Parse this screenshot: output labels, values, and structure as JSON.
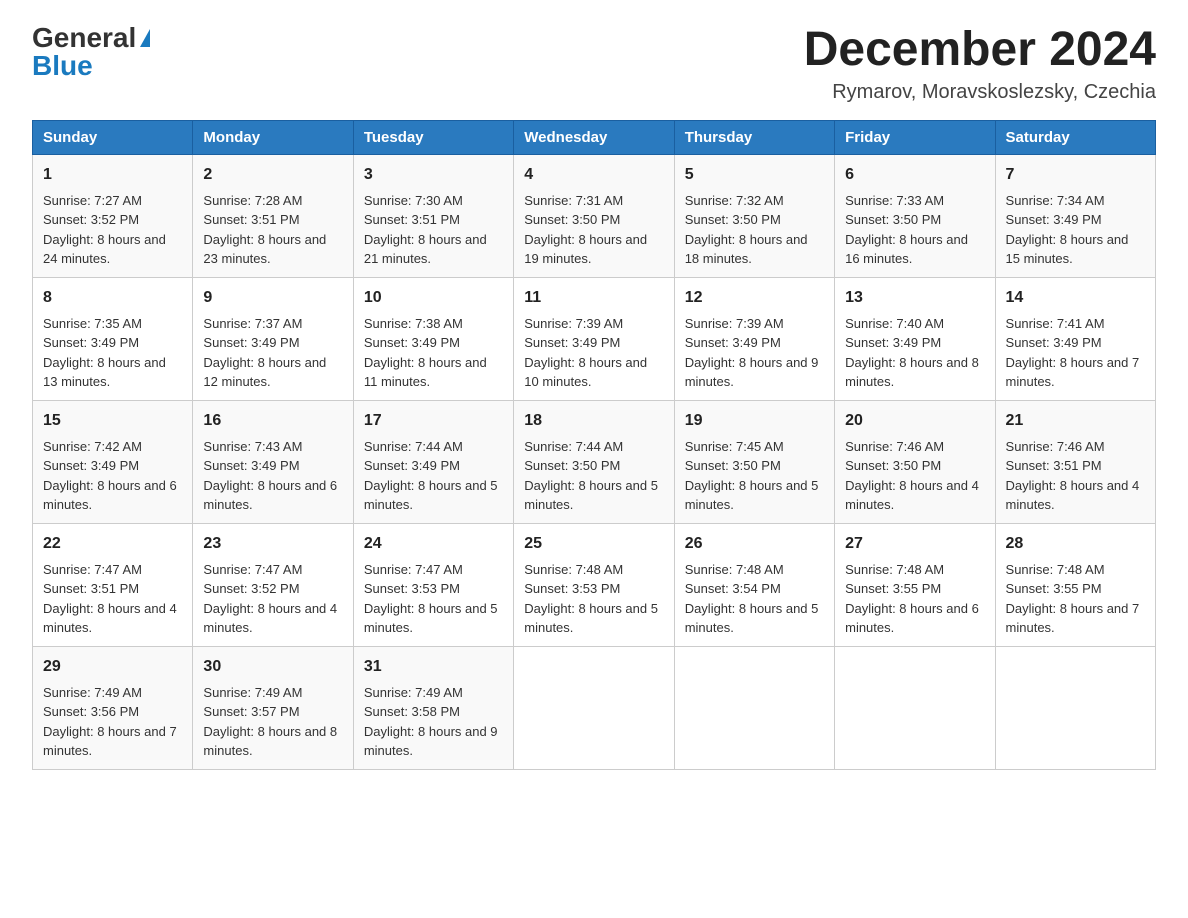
{
  "header": {
    "logo_general": "General",
    "logo_blue": "Blue",
    "month_title": "December 2024",
    "location": "Rymarov, Moravskoslezsky, Czechia"
  },
  "weekdays": [
    "Sunday",
    "Monday",
    "Tuesday",
    "Wednesday",
    "Thursday",
    "Friday",
    "Saturday"
  ],
  "weeks": [
    [
      {
        "day": "1",
        "sunrise": "7:27 AM",
        "sunset": "3:52 PM",
        "daylight": "8 hours and 24 minutes."
      },
      {
        "day": "2",
        "sunrise": "7:28 AM",
        "sunset": "3:51 PM",
        "daylight": "8 hours and 23 minutes."
      },
      {
        "day": "3",
        "sunrise": "7:30 AM",
        "sunset": "3:51 PM",
        "daylight": "8 hours and 21 minutes."
      },
      {
        "day": "4",
        "sunrise": "7:31 AM",
        "sunset": "3:50 PM",
        "daylight": "8 hours and 19 minutes."
      },
      {
        "day": "5",
        "sunrise": "7:32 AM",
        "sunset": "3:50 PM",
        "daylight": "8 hours and 18 minutes."
      },
      {
        "day": "6",
        "sunrise": "7:33 AM",
        "sunset": "3:50 PM",
        "daylight": "8 hours and 16 minutes."
      },
      {
        "day": "7",
        "sunrise": "7:34 AM",
        "sunset": "3:49 PM",
        "daylight": "8 hours and 15 minutes."
      }
    ],
    [
      {
        "day": "8",
        "sunrise": "7:35 AM",
        "sunset": "3:49 PM",
        "daylight": "8 hours and 13 minutes."
      },
      {
        "day": "9",
        "sunrise": "7:37 AM",
        "sunset": "3:49 PM",
        "daylight": "8 hours and 12 minutes."
      },
      {
        "day": "10",
        "sunrise": "7:38 AM",
        "sunset": "3:49 PM",
        "daylight": "8 hours and 11 minutes."
      },
      {
        "day": "11",
        "sunrise": "7:39 AM",
        "sunset": "3:49 PM",
        "daylight": "8 hours and 10 minutes."
      },
      {
        "day": "12",
        "sunrise": "7:39 AM",
        "sunset": "3:49 PM",
        "daylight": "8 hours and 9 minutes."
      },
      {
        "day": "13",
        "sunrise": "7:40 AM",
        "sunset": "3:49 PM",
        "daylight": "8 hours and 8 minutes."
      },
      {
        "day": "14",
        "sunrise": "7:41 AM",
        "sunset": "3:49 PM",
        "daylight": "8 hours and 7 minutes."
      }
    ],
    [
      {
        "day": "15",
        "sunrise": "7:42 AM",
        "sunset": "3:49 PM",
        "daylight": "8 hours and 6 minutes."
      },
      {
        "day": "16",
        "sunrise": "7:43 AM",
        "sunset": "3:49 PM",
        "daylight": "8 hours and 6 minutes."
      },
      {
        "day": "17",
        "sunrise": "7:44 AM",
        "sunset": "3:49 PM",
        "daylight": "8 hours and 5 minutes."
      },
      {
        "day": "18",
        "sunrise": "7:44 AM",
        "sunset": "3:50 PM",
        "daylight": "8 hours and 5 minutes."
      },
      {
        "day": "19",
        "sunrise": "7:45 AM",
        "sunset": "3:50 PM",
        "daylight": "8 hours and 5 minutes."
      },
      {
        "day": "20",
        "sunrise": "7:46 AM",
        "sunset": "3:50 PM",
        "daylight": "8 hours and 4 minutes."
      },
      {
        "day": "21",
        "sunrise": "7:46 AM",
        "sunset": "3:51 PM",
        "daylight": "8 hours and 4 minutes."
      }
    ],
    [
      {
        "day": "22",
        "sunrise": "7:47 AM",
        "sunset": "3:51 PM",
        "daylight": "8 hours and 4 minutes."
      },
      {
        "day": "23",
        "sunrise": "7:47 AM",
        "sunset": "3:52 PM",
        "daylight": "8 hours and 4 minutes."
      },
      {
        "day": "24",
        "sunrise": "7:47 AM",
        "sunset": "3:53 PM",
        "daylight": "8 hours and 5 minutes."
      },
      {
        "day": "25",
        "sunrise": "7:48 AM",
        "sunset": "3:53 PM",
        "daylight": "8 hours and 5 minutes."
      },
      {
        "day": "26",
        "sunrise": "7:48 AM",
        "sunset": "3:54 PM",
        "daylight": "8 hours and 5 minutes."
      },
      {
        "day": "27",
        "sunrise": "7:48 AM",
        "sunset": "3:55 PM",
        "daylight": "8 hours and 6 minutes."
      },
      {
        "day": "28",
        "sunrise": "7:48 AM",
        "sunset": "3:55 PM",
        "daylight": "8 hours and 7 minutes."
      }
    ],
    [
      {
        "day": "29",
        "sunrise": "7:49 AM",
        "sunset": "3:56 PM",
        "daylight": "8 hours and 7 minutes."
      },
      {
        "day": "30",
        "sunrise": "7:49 AM",
        "sunset": "3:57 PM",
        "daylight": "8 hours and 8 minutes."
      },
      {
        "day": "31",
        "sunrise": "7:49 AM",
        "sunset": "3:58 PM",
        "daylight": "8 hours and 9 minutes."
      },
      null,
      null,
      null,
      null
    ]
  ],
  "labels": {
    "sunrise": "Sunrise:",
    "sunset": "Sunset:",
    "daylight": "Daylight:"
  }
}
